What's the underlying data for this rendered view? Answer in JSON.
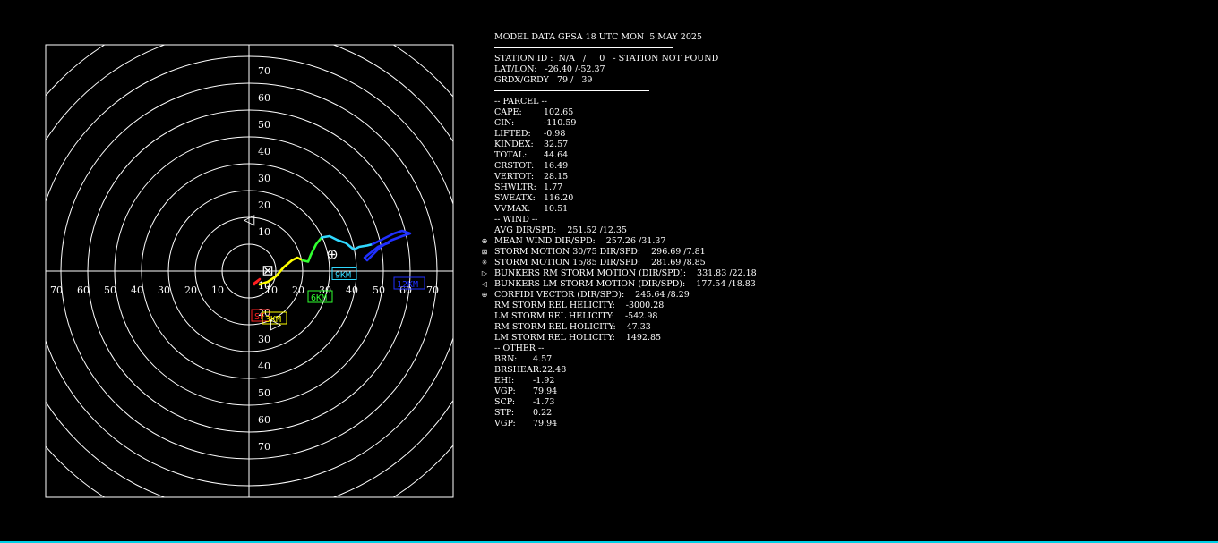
{
  "header": {
    "title": "MODEL DATA GFSA 18 UTC MON  5 MAY 2025",
    "station": "STATION ID :  N/A   /     0   - STATION NOT FOUND",
    "latlon_label": "LAT/LON:",
    "latlon_value": "-26.40 /-52.37",
    "grd_label": "GRDX/GRDY",
    "grd_value": "79 /   39"
  },
  "parcel": {
    "heading": "-- PARCEL --",
    "rows": [
      {
        "label": "CAPE:",
        "value": "102.65"
      },
      {
        "label": "CIN:",
        "value": "-110.59"
      },
      {
        "label": "LIFTED:",
        "value": "-0.98"
      },
      {
        "label": "KINDEX:",
        "value": "32.57"
      },
      {
        "label": "TOTAL:",
        "value": "44.64"
      },
      {
        "label": "CRSTOT:",
        "value": "16.49"
      },
      {
        "label": "VERTOT:",
        "value": "28.15"
      },
      {
        "label": "SHWLTR:",
        "value": "1.77"
      },
      {
        "label": "SWEATX:",
        "value": "116.20"
      },
      {
        "label": "VVMAX:",
        "value": "10.51"
      }
    ]
  },
  "wind": {
    "heading": "-- WIND --",
    "rows": [
      {
        "label": "AVG DIR/SPD:",
        "value": "251.52 /12.35",
        "icon": ""
      },
      {
        "label": "MEAN WIND DIR/SPD:",
        "value": "257.26 /31.37",
        "icon": "⊕"
      },
      {
        "label": "STORM MOTION 30/75 DIR/SPD:",
        "value": "296.69 /7.81",
        "icon": "⊠"
      },
      {
        "label": "STORM MOTION 15/85 DIR/SPD:",
        "value": "281.69 /8.85",
        "icon": "✳"
      },
      {
        "label": "BUNKERS RM STORM MOTION (DIR/SPD):",
        "value": "331.83 /22.18",
        "icon": "▷"
      },
      {
        "label": "BUNKERS LM STORM MOTION (DIR/SPD):",
        "value": "177.54 /18.83",
        "icon": "◁"
      },
      {
        "label": "CORFIDI VECTOR (DIR/SPD):",
        "value": "245.64 /8.29",
        "icon": "⊕"
      },
      {
        "label": "RM STORM REL HELICITY:",
        "value": "-3000.28",
        "icon": ""
      },
      {
        "label": "LM STORM REL HELICITY:",
        "value": "-542.98",
        "icon": ""
      },
      {
        "label": "RM STORM REL HOLICITY:",
        "value": "47.33",
        "icon": ""
      },
      {
        "label": "LM STORM REL HOLICITY:",
        "value": "1492.85",
        "icon": ""
      }
    ]
  },
  "other": {
    "heading": "-- OTHER --",
    "rows": [
      {
        "label": "BRN:",
        "value": "4.57"
      },
      {
        "label": "BRSHEAR:",
        "value": "22.48"
      },
      {
        "label": "EHI:",
        "value": "-1.92"
      },
      {
        "label": "VGP:",
        "value": "79.94"
      },
      {
        "label": "SCP:",
        "value": "-1.73"
      },
      {
        "label": "STP:",
        "value": "0.22"
      },
      {
        "label": "VGP:",
        "value": "79.94"
      }
    ]
  },
  "chart_data": {
    "type": "scatter",
    "kind": "hodograph",
    "ring_step": 10,
    "max_ring": 70,
    "x_ticks": [
      70,
      60,
      50,
      40,
      30,
      20,
      10,
      10,
      20,
      30,
      40,
      50,
      60,
      70
    ],
    "y_ticks": [
      70,
      60,
      50,
      40,
      30,
      20,
      10,
      10,
      20,
      30,
      40,
      50,
      60,
      70
    ],
    "hodograph_segments": [
      {
        "color": "#ff2020",
        "points": [
          [
            2,
            -5
          ],
          [
            3,
            -4
          ],
          [
            4,
            -3
          ],
          [
            2,
            -4.5
          ]
        ]
      },
      {
        "color": "#ffff00",
        "points": [
          [
            4,
            -5
          ],
          [
            7,
            -4
          ],
          [
            10,
            -2
          ],
          [
            13,
            1.5
          ],
          [
            16,
            4
          ],
          [
            18,
            5
          ],
          [
            20,
            4
          ]
        ]
      },
      {
        "color": "#30ff30",
        "points": [
          [
            20,
            4
          ],
          [
            22,
            3.5
          ],
          [
            23,
            6
          ],
          [
            25,
            10
          ],
          [
            27,
            12.5
          ]
        ]
      },
      {
        "color": "#30d8ff",
        "points": [
          [
            27,
            12.5
          ],
          [
            30,
            13
          ],
          [
            33,
            11.5
          ],
          [
            36,
            10.5
          ],
          [
            39,
            8
          ],
          [
            41,
            9
          ],
          [
            44,
            9.5
          ],
          [
            46,
            10
          ]
        ]
      },
      {
        "color": "#2030ff",
        "points": [
          [
            46,
            10
          ],
          [
            50,
            12
          ],
          [
            54,
            14
          ],
          [
            57,
            15
          ],
          [
            60,
            14
          ],
          [
            57,
            13
          ],
          [
            53,
            11.5
          ],
          [
            49,
            9
          ],
          [
            47,
            7
          ],
          [
            45,
            5
          ],
          [
            44,
            4
          ],
          [
            43,
            5
          ],
          [
            48,
            9
          ],
          [
            52,
            10.5
          ]
        ]
      }
    ],
    "height_labels": [
      {
        "text": "SF",
        "u": 1,
        "v": -17,
        "color": "#ff2020"
      },
      {
        "text": "3KM",
        "u": 5,
        "v": -18,
        "color": "#ffff00"
      },
      {
        "text": "6KM",
        "u": 22,
        "v": -10,
        "color": "#30ff30"
      },
      {
        "text": "9KM",
        "u": 31,
        "v": -1.5,
        "color": "#30d8ff"
      },
      {
        "text": "12KM",
        "u": 54,
        "v": -5,
        "color": "#2030ff"
      }
    ],
    "markers": [
      {
        "name": "bunkers-lm-marker",
        "symbol": "◁",
        "u": 0,
        "v": 19
      },
      {
        "name": "bunkers-rm-marker",
        "symbol": "▷",
        "u": 10,
        "v": -20
      },
      {
        "name": "mean-wind-marker",
        "symbol": "⊕",
        "u": 31,
        "v": 6
      },
      {
        "name": "storm-motion-marker",
        "symbol": "⊠",
        "u": 7,
        "v": 0
      }
    ]
  }
}
